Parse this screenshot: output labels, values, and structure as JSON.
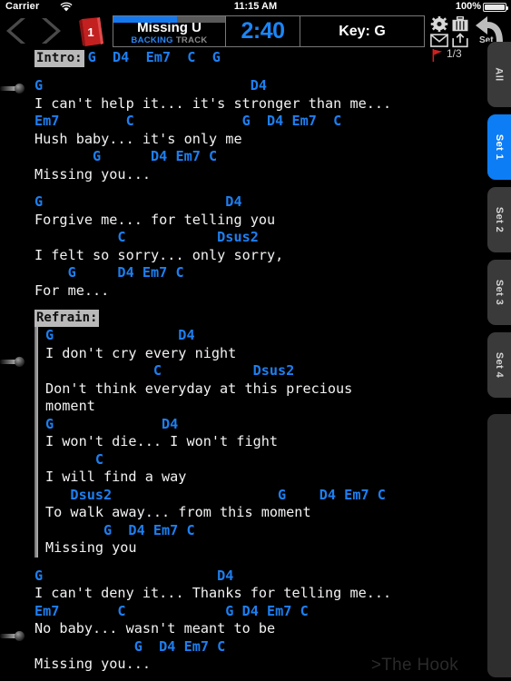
{
  "status_bar": {
    "carrier": "Carrier",
    "wifi_icon": "wifi-icon",
    "time": "11:15 AM",
    "battery_percent": "100%",
    "battery_icon": "battery-full-icon"
  },
  "toolbar": {
    "prev_icon": "chevron-left-icon",
    "next_icon": "chevron-right-icon",
    "songbook_icon": "songbook-icon",
    "songbook_number": "1",
    "song_title": "Missing U",
    "song_subtitle_primary": "BACKING",
    "song_subtitle_secondary": "TRACK",
    "progress_percent": 57,
    "time_remaining": "2:40",
    "key_label": "Key: G",
    "settings_icon": "gear-icon",
    "toolcase_icon": "briefcase-icon",
    "mail_icon": "envelope-icon",
    "share_icon": "share-box-icon",
    "undo_icon": "undo-arrow-icon",
    "undo_label": "Set"
  },
  "page_counter": {
    "flag_icon": "flag-icon",
    "flag_color": "#d42020",
    "text": "1/3"
  },
  "rail": {
    "tabs": [
      {
        "label": "All",
        "active": false
      },
      {
        "label": "Set 1",
        "active": true
      },
      {
        "label": "Set 2",
        "active": false
      },
      {
        "label": "Set 3",
        "active": false
      },
      {
        "label": "Set 4",
        "active": false
      }
    ]
  },
  "handles": [
    {
      "name": "scroll-handle-top"
    },
    {
      "name": "scroll-handle-middle"
    },
    {
      "name": "scroll-handle-bottom"
    }
  ],
  "colors": {
    "chord": "#1d7ff0",
    "lyric": "#f2f2f2",
    "accent": "#0d7df5",
    "section_label_bg": "#b9b9b9",
    "background": "#000000"
  },
  "song": {
    "sections": [
      {
        "name": "intro",
        "label": "Intro:",
        "style": "plain",
        "label_inline_chords": "G  D4  Em7  C  G",
        "lines": []
      },
      {
        "name": "verse-1",
        "label": null,
        "style": "plain",
        "lines": [
          {
            "chords": "G                         D4",
            "lyric": "I can't help it... it's stronger than me..."
          },
          {
            "chords": "Em7        C             G  D4 Em7  C",
            "lyric": "Hush baby... it's only me"
          },
          {
            "chords": "       G      D4 Em7 C",
            "lyric": "Missing you..."
          }
        ]
      },
      {
        "name": "verse-2",
        "label": null,
        "style": "plain",
        "lines": [
          {
            "chords": "G                      D4",
            "lyric": "Forgive me... for telling you"
          },
          {
            "chords": "          C           Dsus2",
            "lyric": "I felt so sorry... only sorry,"
          },
          {
            "chords": "    G     D4 Em7 C",
            "lyric": "For me..."
          }
        ]
      },
      {
        "name": "refrain",
        "label": "Refrain:",
        "style": "refrain",
        "lines": [
          {
            "chords": "G               D4",
            "lyric": "I don't cry every night"
          },
          {
            "chords": "             C           Dsus2",
            "lyric": "Don't think everyday at this precious"
          },
          {
            "chords": "",
            "lyric": "moment"
          },
          {
            "chords": "G             D4",
            "lyric": "I won't die... I won't fight"
          },
          {
            "chords": "      C",
            "lyric": "I will find a way"
          },
          {
            "chords": "   Dsus2                    G    D4 Em7 C",
            "lyric": "To walk away... from this moment"
          },
          {
            "chords": "       G  D4 Em7 C",
            "lyric": "Missing you"
          }
        ]
      },
      {
        "name": "verse-3",
        "label": null,
        "style": "plain",
        "lines": [
          {
            "chords": "G                     D4",
            "lyric": "I can't deny it... Thanks for telling me..."
          },
          {
            "chords": "Em7       C            G D4 Em7 C",
            "lyric": "No baby... wasn't meant to be"
          },
          {
            "chords": "            G  D4 Em7 C",
            "lyric": "Missing you..."
          }
        ]
      }
    ]
  },
  "watermark": {
    "text": ">The Hook"
  }
}
